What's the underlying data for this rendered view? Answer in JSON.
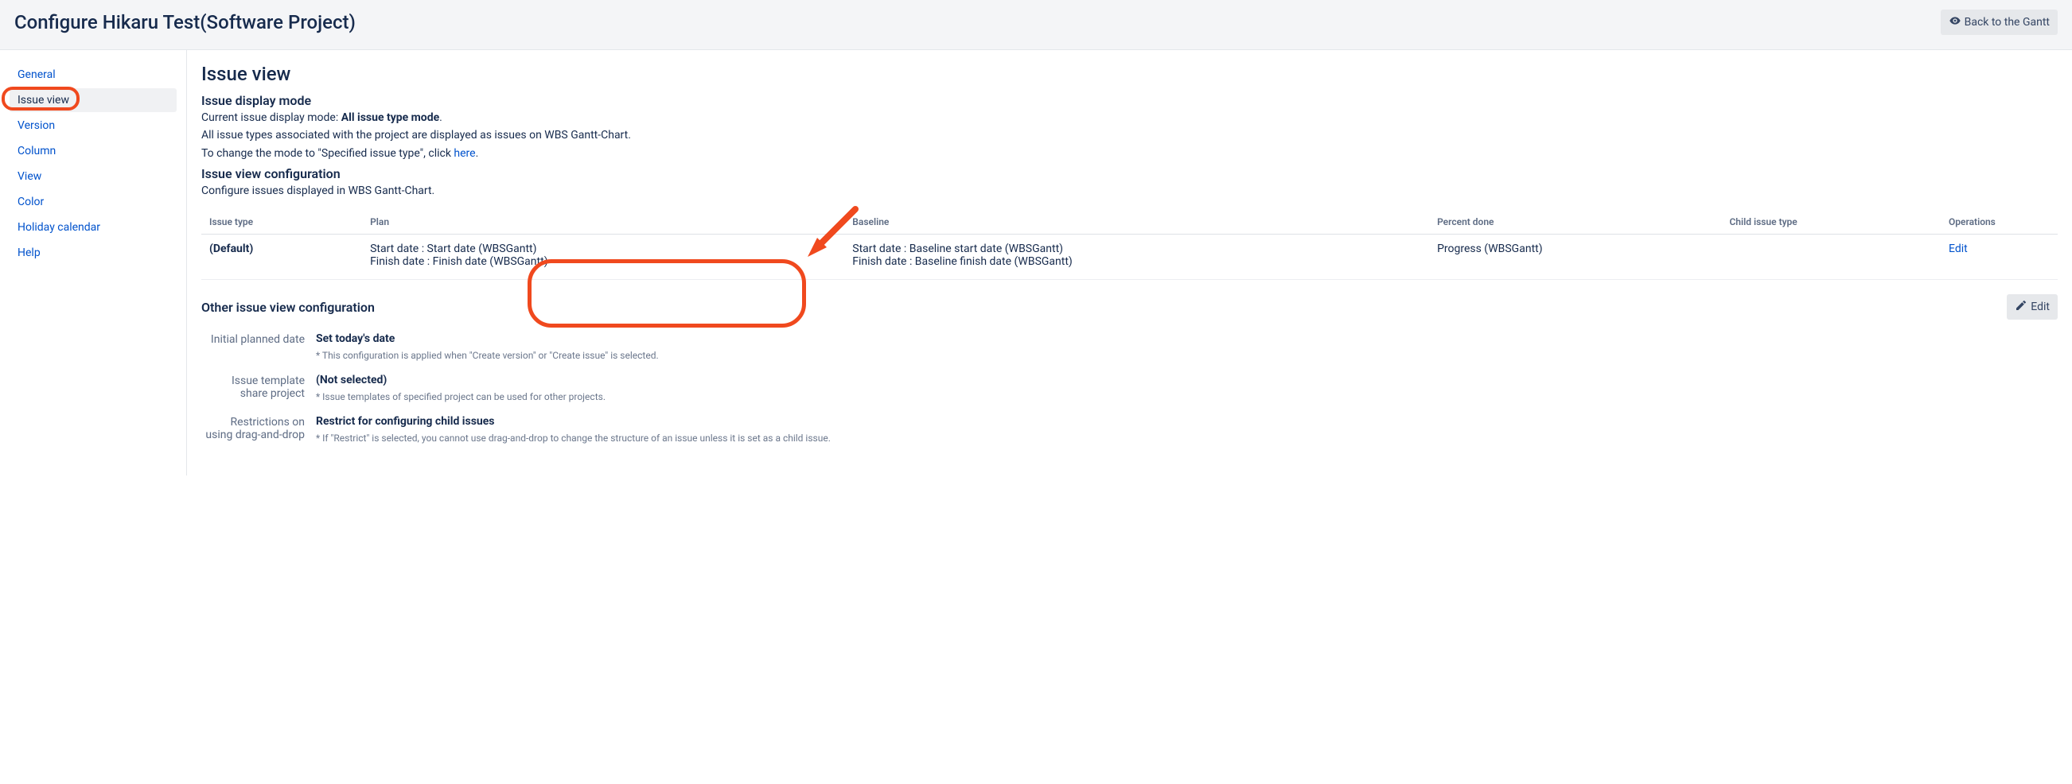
{
  "header": {
    "title": "Configure Hikaru Test(Software Project)",
    "back_button": "Back to the Gantt"
  },
  "sidebar": {
    "items": [
      {
        "label": "General"
      },
      {
        "label": "Issue view"
      },
      {
        "label": "Version"
      },
      {
        "label": "Column"
      },
      {
        "label": "View"
      },
      {
        "label": "Color"
      },
      {
        "label": "Holiday calendar"
      },
      {
        "label": "Help"
      }
    ],
    "active_index": 1
  },
  "main": {
    "heading": "Issue view",
    "display_mode": {
      "title": "Issue display mode",
      "current_prefix": "Current issue display mode: ",
      "current_value": "All issue type mode",
      "current_suffix": ".",
      "line2": "All issue types associated with the project are displayed as issues on WBS Gantt-Chart.",
      "line3_prefix": "To change the mode to \"Specified issue type\", click ",
      "line3_link": "here",
      "line3_suffix": "."
    },
    "config": {
      "title": "Issue view configuration",
      "desc": "Configure issues displayed in WBS Gantt-Chart.",
      "columns": {
        "issue_type": "Issue type",
        "plan": "Plan",
        "baseline": "Baseline",
        "percent_done": "Percent done",
        "child_issue_type": "Child issue type",
        "operations": "Operations"
      },
      "row": {
        "issue_type": "(Default)",
        "plan_line1": "Start date : Start date (WBSGantt)",
        "plan_line2": "Finish date : Finish date (WBSGantt)",
        "baseline_line1": "Start date : Baseline start date (WBSGantt)",
        "baseline_line2": "Finish date : Baseline finish date (WBSGantt)",
        "percent_done": "Progress (WBSGantt)",
        "child_issue_type": "",
        "operations": "Edit"
      }
    },
    "other": {
      "title": "Other issue view configuration",
      "edit": "Edit",
      "rows": [
        {
          "label": "Initial planned date",
          "value": "Set today's date",
          "hint": "* This configuration is applied when \"Create version\" or \"Create issue\" is selected."
        },
        {
          "label": "Issue template share project",
          "value": "(Not selected)",
          "hint": "* Issue templates of specified project can be used for other projects."
        },
        {
          "label": "Restrictions on using drag-and-drop",
          "value": "Restrict for configuring child issues",
          "hint": "* If \"Restrict\" is selected, you cannot use drag-and-drop to change the structure of an issue unless it is set as a child issue."
        }
      ]
    }
  }
}
